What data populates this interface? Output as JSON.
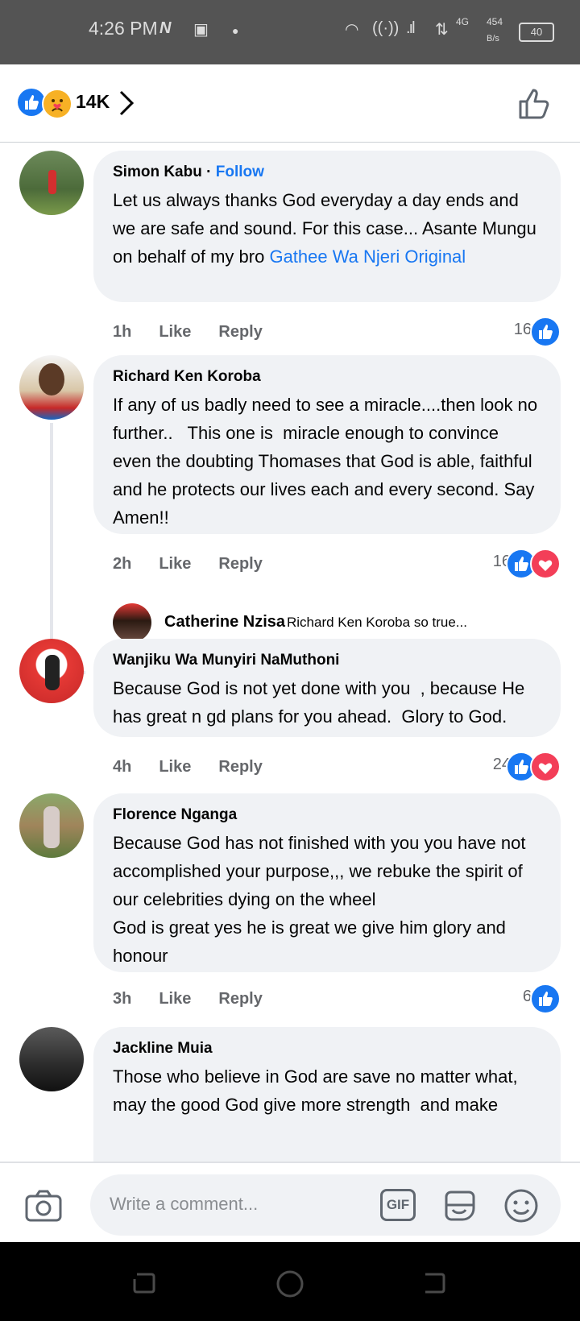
{
  "status_bar": {
    "time": "4:26 PM",
    "net_type": "4G",
    "speed_value": "454",
    "speed_unit": "B/s",
    "battery": "40"
  },
  "reactions": {
    "count": "14K"
  },
  "comments": [
    {
      "name": "Simon Kabu",
      "follow_label": "Follow",
      "text": "Let us always thanks God everyday a day ends and we are safe and sound. For this case... Asante Mungu on behalf of my bro ",
      "mention": "Gathee Wa Njeri Original",
      "time": "1h",
      "like_label": "Like",
      "reply_label": "Reply",
      "reaction_count": "16"
    },
    {
      "name": "Richard Ken Koroba",
      "text": "If any of us badly need to see a miracle....then look no further..   This one is  miracle enough to convince even the doubting Thomases that God is able, faithful and he protects our lives each and every second. Say Amen!!",
      "time": "2h",
      "like_label": "Like",
      "reply_label": "Reply",
      "reaction_count": "16"
    },
    {
      "name": "Wanjiku Wa Munyiri NaMuthoni",
      "text": "Because God is not yet done with you  , because He has great n gd plans for you ahead.  Glory to God.",
      "time": "4h",
      "like_label": "Like",
      "reply_label": "Reply",
      "reaction_count": "24"
    },
    {
      "name": "Florence Nganga",
      "text": "Because God has not finished with you you have not accomplished your purpose,,, we rebuke the spirit of our celebrities dying on the wheel\nGod is great yes he is great we give him glory and honour",
      "time": "3h",
      "like_label": "Like",
      "reply_label": "Reply",
      "reaction_count": "6"
    },
    {
      "name": "Jackline Muia",
      "text": "Those who believe in God are save no matter what, may the good God give more strength  and make"
    }
  ],
  "reply": {
    "name": "Catherine Nzisa",
    "text": "Richard Ken Koroba so true..."
  },
  "composer": {
    "placeholder": "Write a comment...",
    "gif_label": "GIF"
  },
  "colors": {
    "accent": "#1877f2",
    "bubble": "#f0f2f5",
    "love": "#f33e58",
    "status_bar": "#545454"
  }
}
